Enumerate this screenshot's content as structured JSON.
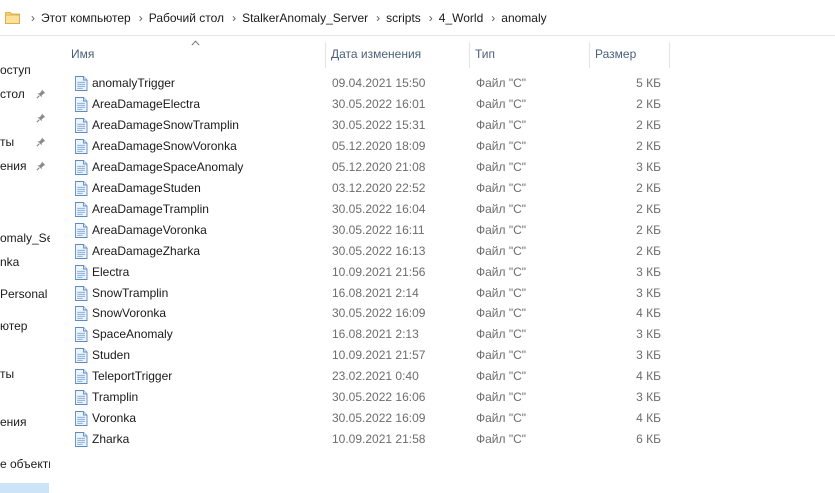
{
  "address": {
    "crumbs": [
      "Этот компьютер",
      "Рабочий стол",
      "StalkerAnomaly_Server",
      "scripts",
      "4_World",
      "anomaly"
    ]
  },
  "nav": {
    "items": [
      "оступ",
      "стол",
      "ты",
      "ения",
      "omaly_Ser",
      "nka",
      "Personal",
      "ютер",
      "ты",
      "ения",
      "е объекты"
    ]
  },
  "columns": {
    "name": "Имя",
    "date": "Дата изменения",
    "type": "Тип",
    "size": "Размер"
  },
  "files": [
    {
      "name": "anomalyTrigger",
      "date": "09.04.2021 15:50",
      "type": "Файл \"C\"",
      "size": "5 КБ"
    },
    {
      "name": "AreaDamageElectra",
      "date": "30.05.2022 16:01",
      "type": "Файл \"C\"",
      "size": "2 КБ"
    },
    {
      "name": "AreaDamageSnowTramplin",
      "date": "30.05.2022 15:31",
      "type": "Файл \"C\"",
      "size": "2 КБ"
    },
    {
      "name": "AreaDamageSnowVoronka",
      "date": "05.12.2020 18:09",
      "type": "Файл \"C\"",
      "size": "2 КБ"
    },
    {
      "name": "AreaDamageSpaceAnomaly",
      "date": "05.12.2020 21:08",
      "type": "Файл \"C\"",
      "size": "3 КБ"
    },
    {
      "name": "AreaDamageStuden",
      "date": "03.12.2020 22:52",
      "type": "Файл \"C\"",
      "size": "2 КБ"
    },
    {
      "name": "AreaDamageTramplin",
      "date": "30.05.2022 16:04",
      "type": "Файл \"C\"",
      "size": "2 КБ"
    },
    {
      "name": "AreaDamageVoronka",
      "date": "30.05.2022 16:11",
      "type": "Файл \"C\"",
      "size": "2 КБ"
    },
    {
      "name": "AreaDamageZharka",
      "date": "30.05.2022 16:13",
      "type": "Файл \"C\"",
      "size": "2 КБ"
    },
    {
      "name": "Electra",
      "date": "10.09.2021 21:56",
      "type": "Файл \"C\"",
      "size": "3 КБ"
    },
    {
      "name": "SnowTramplin",
      "date": "16.08.2021 2:14",
      "type": "Файл \"C\"",
      "size": "3 КБ"
    },
    {
      "name": "SnowVoronka",
      "date": "30.05.2022 16:09",
      "type": "Файл \"C\"",
      "size": "4 КБ"
    },
    {
      "name": "SpaceAnomaly",
      "date": "16.08.2021 2:13",
      "type": "Файл \"C\"",
      "size": "3 КБ"
    },
    {
      "name": "Studen",
      "date": "10.09.2021 21:57",
      "type": "Файл \"C\"",
      "size": "3 КБ"
    },
    {
      "name": "TeleportTrigger",
      "date": "23.02.2021 0:40",
      "type": "Файл \"C\"",
      "size": "4 КБ"
    },
    {
      "name": "Tramplin",
      "date": "30.05.2022 16:06",
      "type": "Файл \"C\"",
      "size": "3 КБ"
    },
    {
      "name": "Voronka",
      "date": "30.05.2022 16:09",
      "type": "Файл \"C\"",
      "size": "4 КБ"
    },
    {
      "name": "Zharka",
      "date": "10.09.2021 21:58",
      "type": "Файл \"C\"",
      "size": "6 КБ"
    }
  ],
  "icons": {
    "address_folder": "folder-icon",
    "crumb_separator": "chevron-right-icon",
    "pin": "pin-icon",
    "file": "c-file-icon",
    "sort": "sort-ascending-icon"
  },
  "colors": {
    "header_text": "#4c607a",
    "selection": "#cce4f7",
    "muted_text": "#6d6d6d",
    "folder_yellow": "#f7d26e"
  }
}
